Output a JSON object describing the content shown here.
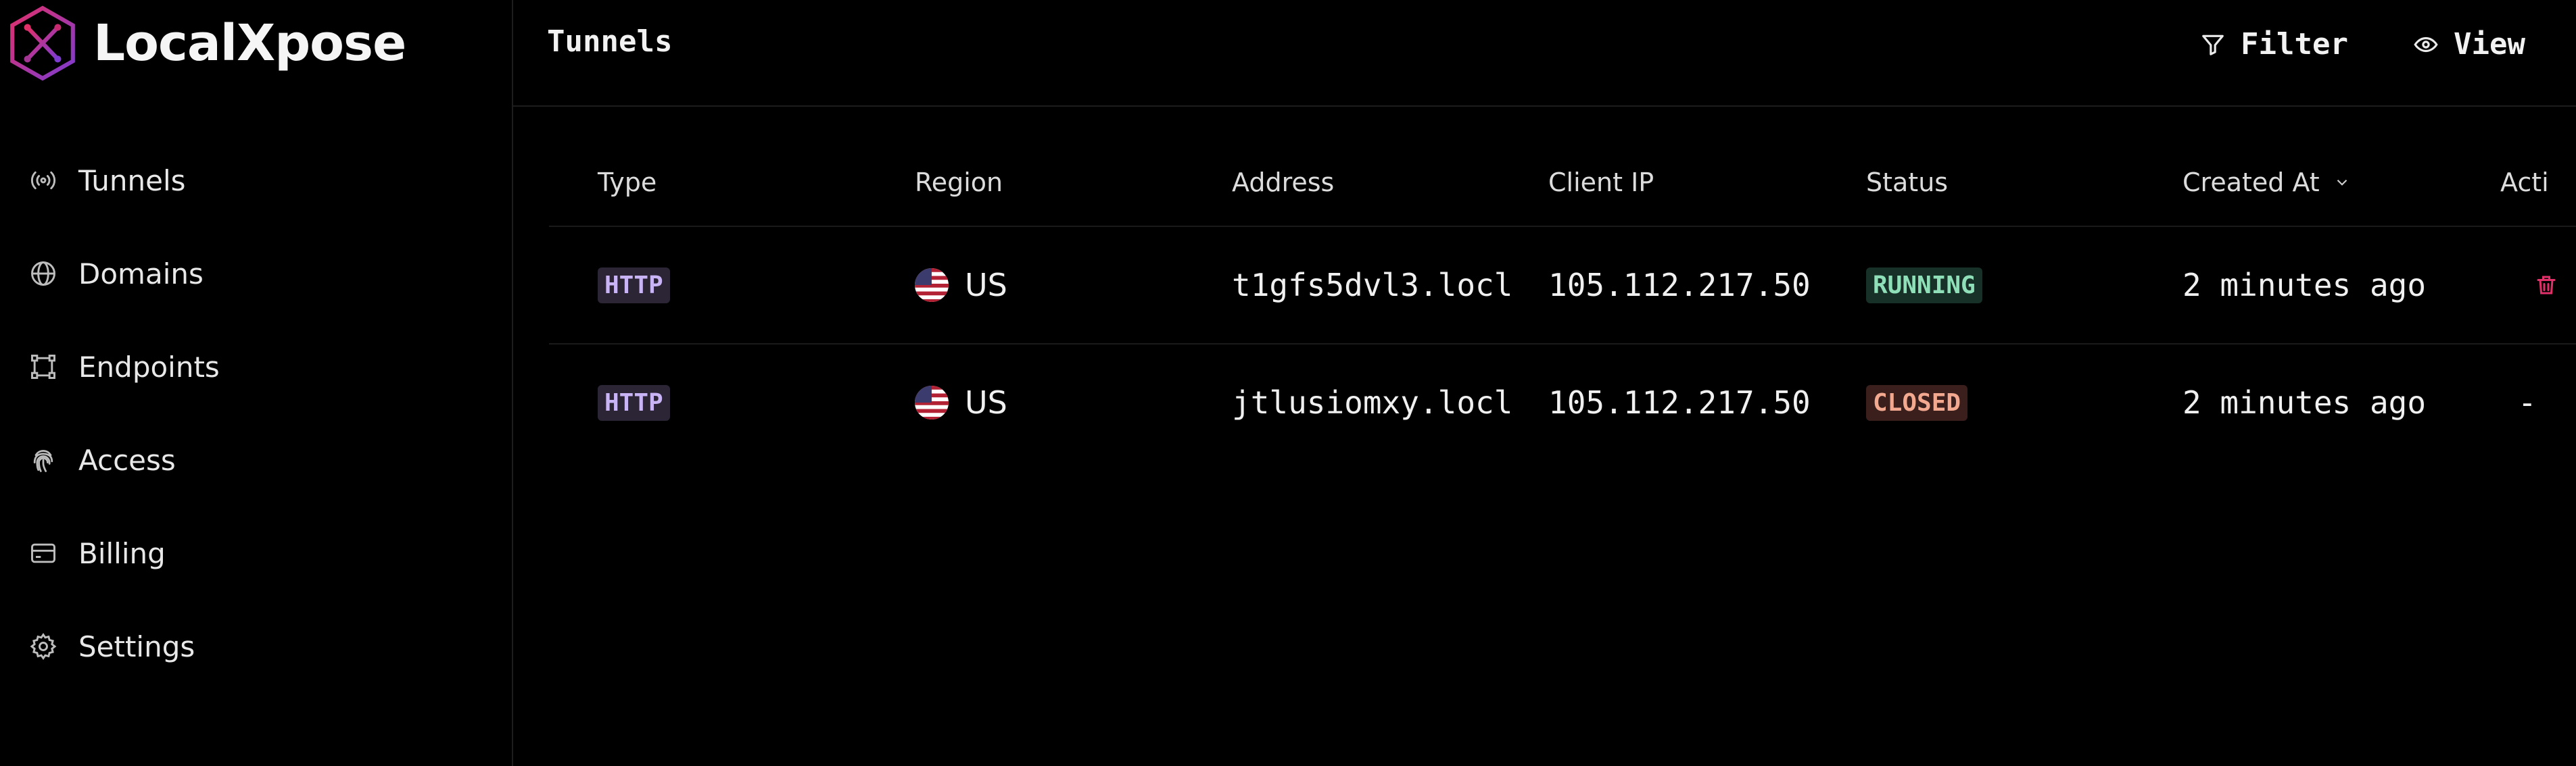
{
  "app": {
    "name": "LocalXpose",
    "brand_colors": {
      "accent": "#c72a6f",
      "purple": "#7d3bd1"
    }
  },
  "sidebar": {
    "items": [
      {
        "label": "Tunnels",
        "icon": "broadcast-icon"
      },
      {
        "label": "Domains",
        "icon": "globe-icon"
      },
      {
        "label": "Endpoints",
        "icon": "vector-square-icon"
      },
      {
        "label": "Access",
        "icon": "fingerprint-icon"
      },
      {
        "label": "Billing",
        "icon": "credit-card-icon"
      },
      {
        "label": "Settings",
        "icon": "gear-icon"
      }
    ]
  },
  "header": {
    "title": "Tunnels",
    "filter_label": "Filter",
    "view_label": "View"
  },
  "table": {
    "columns": [
      "Type",
      "Region",
      "Address",
      "Client IP",
      "Status",
      "Created At",
      "Acti"
    ],
    "rows": [
      {
        "type": "HTTP",
        "region": "US",
        "address": "t1gfs5dvl3.locl",
        "client_ip": "105.112.217.50",
        "status": "RUNNING",
        "created_at": "2 minutes ago",
        "action": "trash-icon"
      },
      {
        "type": "HTTP",
        "region": "US",
        "address": "jtlusiomxy.locl",
        "client_ip": "105.112.217.50",
        "status": "CLOSED",
        "created_at": "2 minutes ago",
        "action": "-"
      }
    ]
  }
}
